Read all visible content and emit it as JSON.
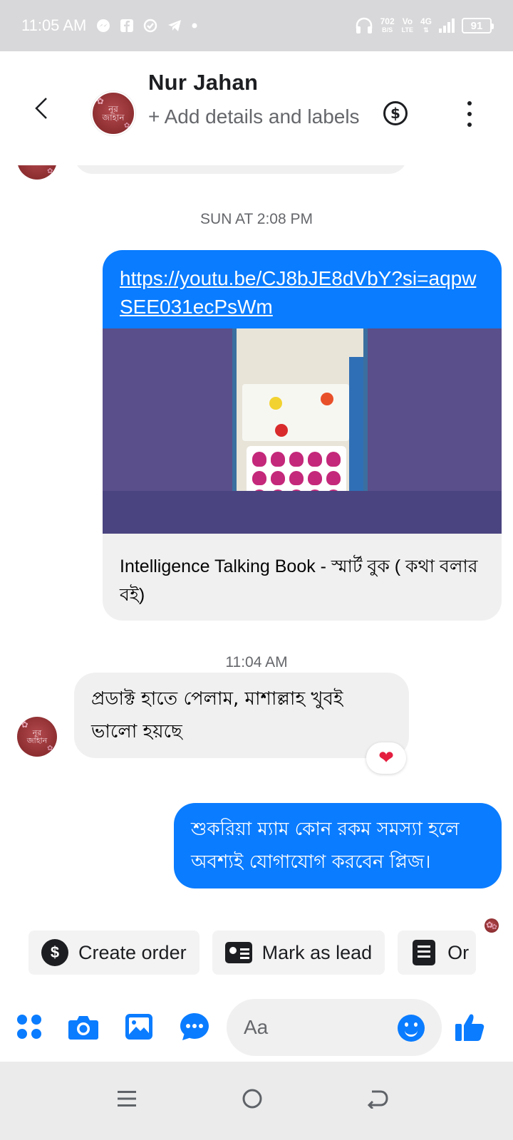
{
  "status_bar": {
    "time": "11:05 AM",
    "net_speed_value": "702",
    "net_speed_unit": "B/S",
    "volte_top": "Vo",
    "volte_bottom": "LTE",
    "network_type": "4G",
    "battery": "91",
    "icons": [
      "messenger-icon",
      "facebook-icon",
      "sync-icon",
      "telegram-icon",
      "dot-icon",
      "headphones-icon",
      "signal-icon",
      "battery-icon"
    ]
  },
  "header": {
    "contact_name": "Nur Jahan",
    "subtitle": "+ Add details and labels",
    "avatar_text": "নূর জাহান",
    "icons": [
      "back-arrow-icon",
      "dollar-circle-icon",
      "more-vertical-icon"
    ]
  },
  "chat": {
    "timestamp_1": "SUN AT 2:08 PM",
    "link_message": {
      "url": "https://youtu.be/CJ8bJE8dVbY?si=aqpwSEE031ecPsWm",
      "preview_title": "Intelligence Talking Book - স্মার্ট বুক ( কথা বলার বই)"
    },
    "timestamp_2": "11:04 AM",
    "incoming_message": "প্রডাক্ট হাতে পেলাম, মাশাল্লাহ খুবই ভালো হয়ছে",
    "reaction": "❤",
    "outgoing_message": "শুকরিয়া ম্যাম কোন রকম সমস্যা হলে অবশ্যই যোগাযোগ করবেন প্লিজ।"
  },
  "quick_actions": {
    "create_order": "Create order",
    "mark_as_lead": "Mark as lead",
    "third_partial": "Or"
  },
  "composer": {
    "placeholder": "Aa",
    "icons": [
      "apps-grid-icon",
      "camera-icon",
      "gallery-icon",
      "chat-bubble-icon",
      "emoji-icon",
      "thumbs-up-icon"
    ]
  },
  "colors": {
    "accent": "#0a7cff",
    "bubble_incoming": "#f0f0f0",
    "status_bar_bg": "#d8d8da",
    "heart": "#e41e3f"
  }
}
